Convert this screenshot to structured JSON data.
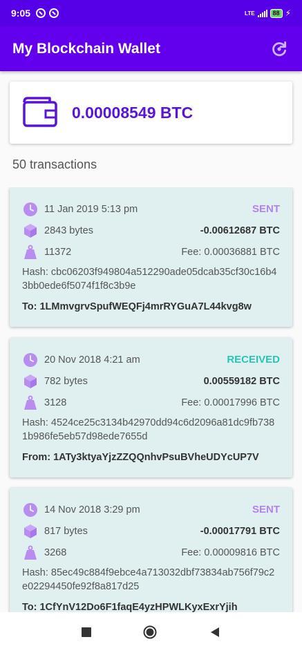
{
  "status_bar": {
    "time": "9:05",
    "network": "LTE",
    "battery": "88"
  },
  "app_bar": {
    "title": "My Blockchain Wallet",
    "refresh_icon": "refresh-icon"
  },
  "balance": {
    "amount": "0.00008549 BTC",
    "icon": "wallet-icon"
  },
  "transactions_count": "50 transactions",
  "colors": {
    "primary": "#6200ee",
    "status_bar": "#5500e6",
    "sent": "#b780f0",
    "received": "#26c6b4",
    "card_bg": "#e0f0f0",
    "icon_purple": "#b98cf0"
  },
  "transactions": [
    {
      "date": "11 Jan 2019 5:13 pm",
      "status": "SENT",
      "size": "2843 bytes",
      "amount": "-0.00612687 BTC",
      "weight": "11372",
      "fee": "Fee: 0.00036881 BTC",
      "hash": "Hash: cbc06203f949804a512290ade05dcab35cf30c16b43bb0ede6f5074f1f8c3b9e",
      "peer": "To: 1LMmvgrvSpufWEQFj4mrRYGuA7L44kvg8w"
    },
    {
      "date": "20 Nov 2018 4:21 am",
      "status": "RECEIVED",
      "size": "782 bytes",
      "amount": "0.00559182 BTC",
      "weight": "3128",
      "fee": "Fee: 0.00017996 BTC",
      "hash": "Hash: 4524ce25c3134b42970dd94c6d2096a81dc9fb7381b986fe5eb57d98ede7655d",
      "peer": "From: 1ATy3ktyaYjzZZQQnhvPsuBVheUDYcUP7V"
    },
    {
      "date": "14 Nov 2018 3:29 pm",
      "status": "SENT",
      "size": "817 bytes",
      "amount": "-0.00017791 BTC",
      "weight": "3268",
      "fee": "Fee: 0.00009816 BTC",
      "hash": "Hash: 85ec49c884f9ebce4a713032dbf73834ab756f79c2e02294450fe92f8a817d25",
      "peer": "To: 1CfYnV12Do6F1faqE4yzHPWLKyxExrYjih"
    }
  ],
  "nav_bar": {
    "recents_icon": "square-icon",
    "home_icon": "circle-icon",
    "back_icon": "triangle-back-icon"
  }
}
